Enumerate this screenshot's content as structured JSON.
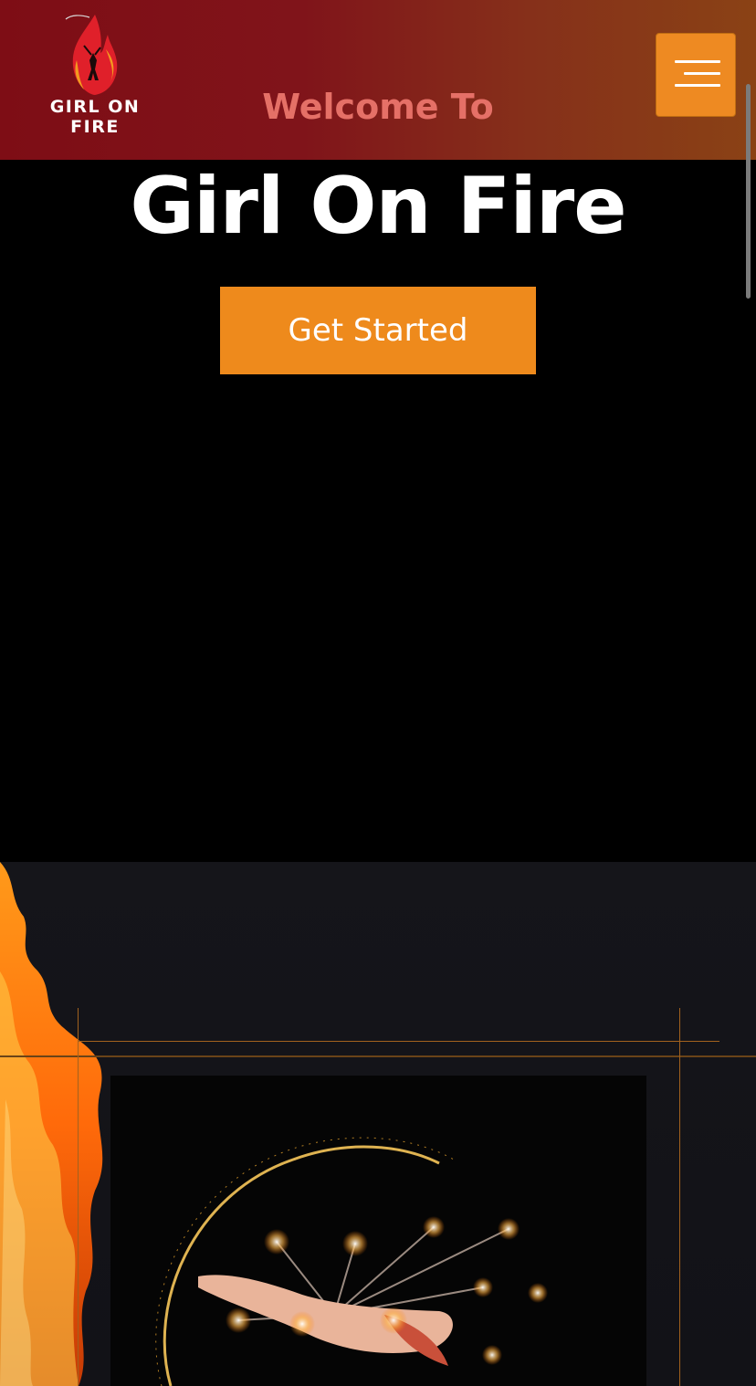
{
  "brand": {
    "logo_text": "GIRL ON FIRE"
  },
  "header": {
    "menu_icon": "hamburger-menu-icon"
  },
  "hero": {
    "welcome": "Welcome To",
    "title": "Girl On Fire",
    "cta_label": "Get Started"
  },
  "gallery": {
    "image_alt": "Fire performer spinning a fire hoop"
  },
  "colors": {
    "accent": "#ee8a1c",
    "welcome_text": "#e57067",
    "header_start": "#7e0d15",
    "header_end": "#8a4215"
  }
}
